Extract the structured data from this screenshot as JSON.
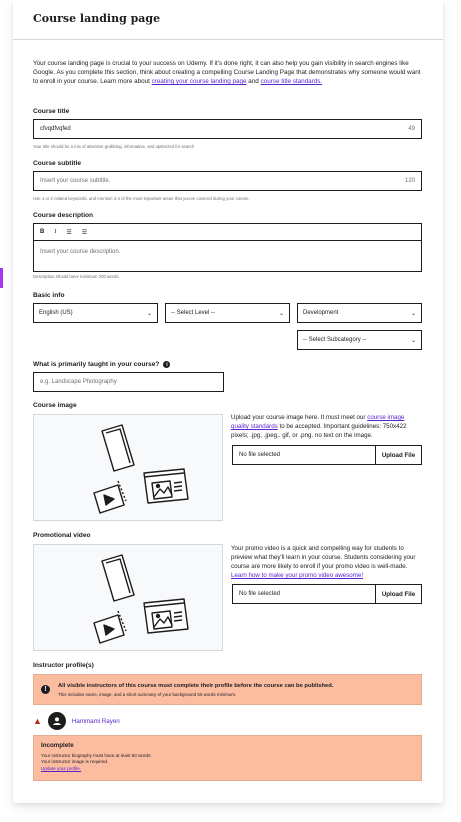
{
  "page": {
    "title": "Course landing page",
    "intro": {
      "text_before": "Your course landing page is crucial to your success on Udemy. If it's done right, it can also help you gain visibility in search engines like Google. As you complete this section, think about creating a compelling Course Landing Page that demonstrates why someone would want to enroll in your course. Learn more about",
      "link1": "creating your course landing page",
      "text_mid": "and",
      "link2": "course title standards."
    }
  },
  "course_title": {
    "label": "Course title",
    "value": "cfvqdfvqfed",
    "count": "49",
    "hint": "Your title should be a mix of attention-grabbing, informative, and optimized for search"
  },
  "course_subtitle": {
    "label": "Course subtitle",
    "placeholder": "Insert your course subtitle.",
    "count": "120",
    "hint": "Use 1 or 2 related keywords, and mention 3-4 of the most important areas that you've covered during your course."
  },
  "course_description": {
    "label": "Course description",
    "toolbar": {
      "bold": "B",
      "italic": "I",
      "ordered": "☰",
      "bullets": "☰"
    },
    "placeholder": "Insert your course description.",
    "hint": "Description should have minimum 200 words."
  },
  "basic_info": {
    "label": "Basic info",
    "language": "English (US)",
    "level": "-- Select Level --",
    "category": "Development",
    "subcategory": "-- Select Subcategory --"
  },
  "primarily_taught": {
    "label": "What is primarily taught in your course?",
    "placeholder": "e.g. Landscape Photography"
  },
  "course_image": {
    "label": "Course image",
    "desc_before": "Upload your course image here. It must meet our",
    "desc_link": "course image quality standards",
    "desc_after": "to be accepted. Important guidelines: 750x422 pixels; .jpg, .jpeg,. gif, or .png. no text on the image.",
    "file_text": "No file selected",
    "button": "Upload File"
  },
  "promo_video": {
    "label": "Promotional video",
    "desc_before": "Your promo video is a quick and compelling way for students to preview what they'll learn in your course. Students considering your course are more likely to enroll if your promo video is well-made.",
    "desc_link": "Learn how to make your promo video awesome!",
    "file_text": "No file selected",
    "button": "Upload File"
  },
  "instructor": {
    "label": "Instructor profile(s)",
    "alert_title": "All visible instructors of this course must complete their profile before the course can be published.",
    "alert_text": "This includes name, image, and a short summary of your background 50 words minimum.",
    "name": "Hammami Rayen",
    "incomplete_title": "Incomplete",
    "incomplete_line1": "Your instructor biography must have at least 50 words.",
    "incomplete_line2": "Your instructor image is required.",
    "incomplete_link": "Update your profile."
  },
  "colors": {
    "accent": "#5624d0",
    "purple_bar": "#a435f0",
    "alert_bg": "#fcbca0",
    "warn_red": "#b32d0f"
  }
}
